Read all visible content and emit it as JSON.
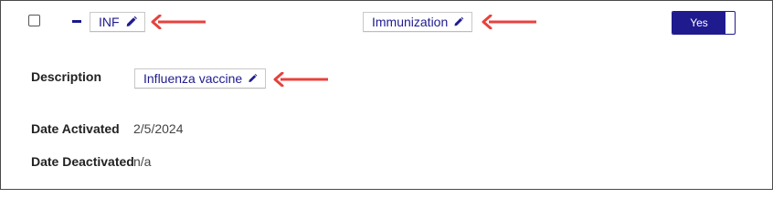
{
  "row": {
    "code": "INF",
    "type": "Immunization",
    "toggle_label": "Yes"
  },
  "details": {
    "description_label": "Description",
    "description_value": "Influenza vaccine",
    "date_activated_label": "Date Activated",
    "date_activated_value": "2/5/2024",
    "date_deactivated_label": "Date Deactivated",
    "date_deactivated_value": "n/a"
  },
  "colors": {
    "accent": "#1f1b8f",
    "arrow": "#e8413c"
  },
  "icons": [
    "pencil-icon",
    "arrow-left-icon",
    "collapse-icon"
  ]
}
